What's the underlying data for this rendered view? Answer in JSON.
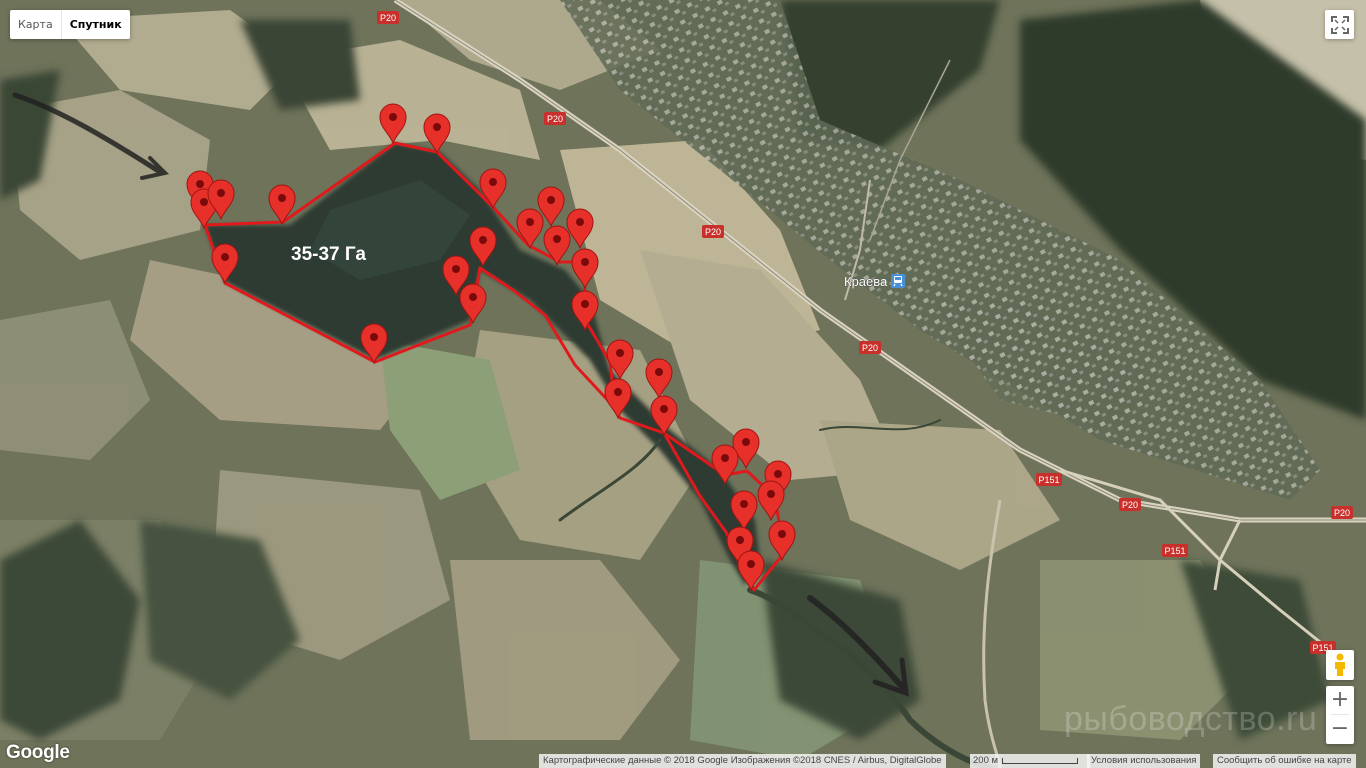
{
  "map_type": {
    "map_label": "Карта",
    "satellite_label": "Спутник",
    "active": "satellite"
  },
  "area_label": "35-37 Га",
  "place_label": "Краева",
  "roads": [
    "P20",
    "P20",
    "P20",
    "P20",
    "P20",
    "P20",
    "P151",
    "P151",
    "P151"
  ],
  "attribution": {
    "data": "Картографические данные © 2018 Google Изображения ©2018 CNES / Airbus, DigitalGlobe",
    "scale": "200 м",
    "terms": "Условия использования",
    "report": "Сообщить об ошибке на карте"
  },
  "watermark": "рыбоводство.ru",
  "logo": "Google",
  "zoom": {
    "in": "+",
    "out": "−"
  },
  "icons": {
    "fullscreen": "fullscreen-icon",
    "pegman": "pegman-icon",
    "marker": "map-marker-icon"
  },
  "colors": {
    "boundary": "#e0191c",
    "marker": "#e8302b",
    "marker_dot": "#7a0a0a"
  }
}
